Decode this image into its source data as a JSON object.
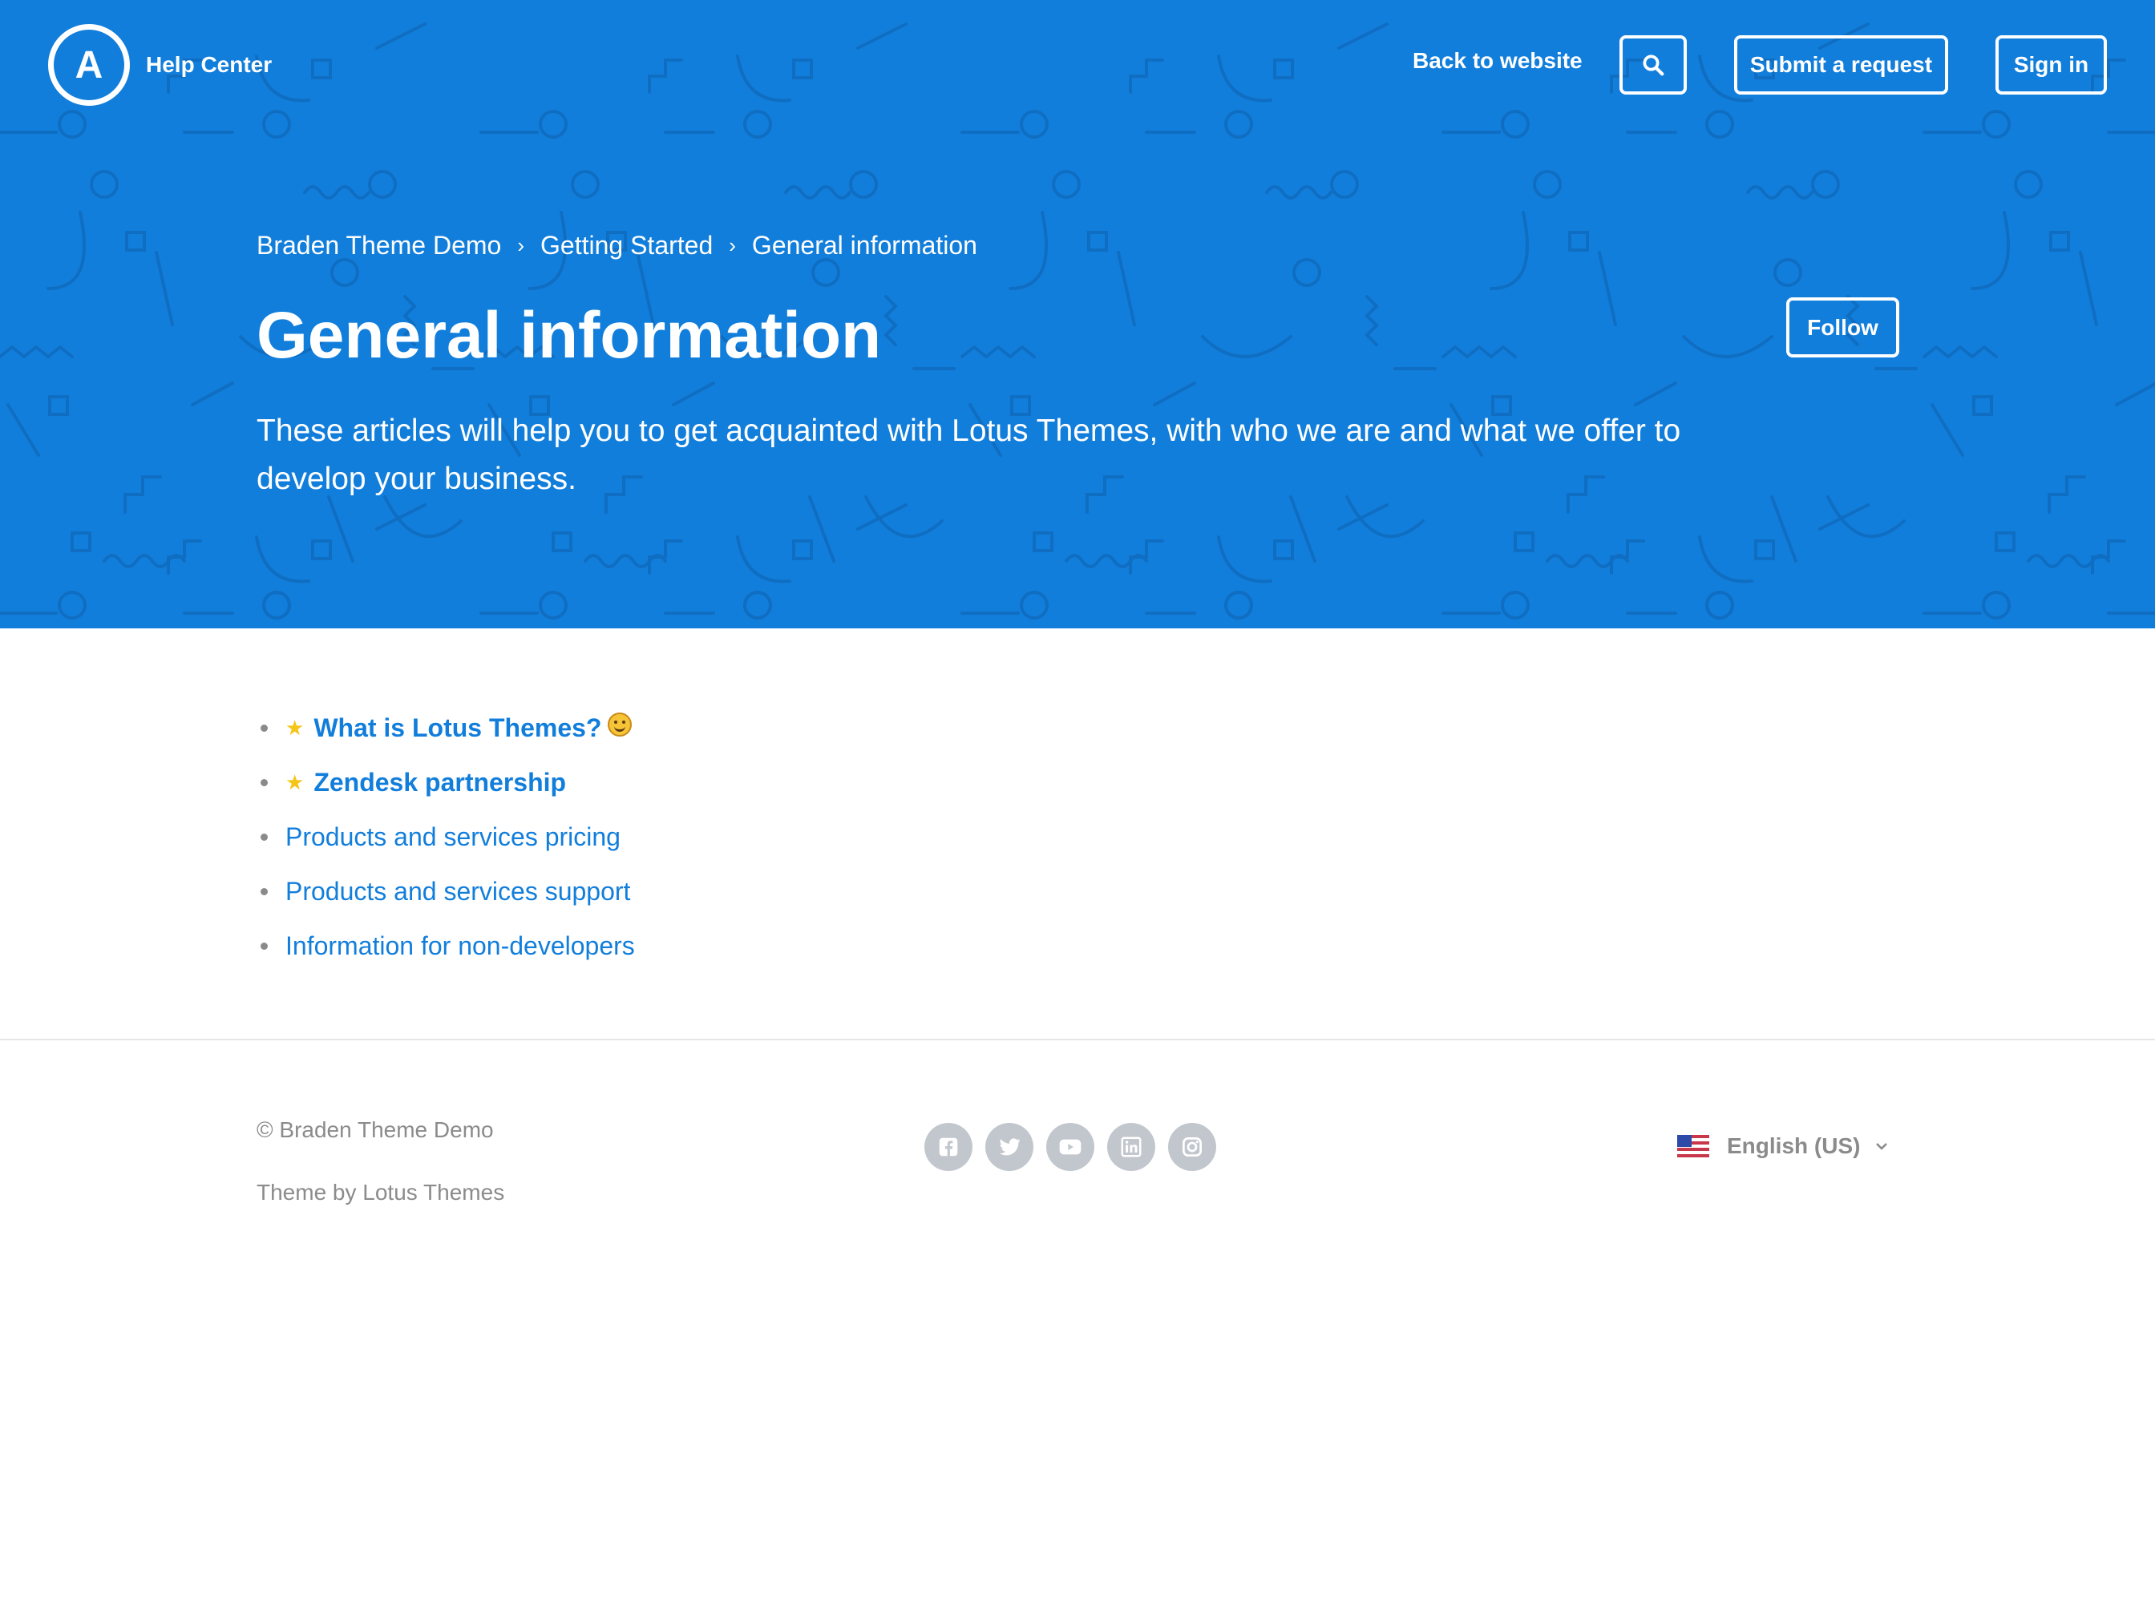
{
  "colors": {
    "brand_blue": "#127edb",
    "header_blue": "#127edb",
    "pattern_stroke": "#0f6ec2",
    "link_blue": "#127edb",
    "star_yellow": "#f5c518",
    "muted_gray": "#8b8b8b",
    "social_gray": "#c2c7ce"
  },
  "header": {
    "logo_letter": "A",
    "logo_text": "Help Center",
    "back_to_website": "Back to website",
    "search_icon": "search-icon",
    "submit_request": "Submit a request",
    "sign_in": "Sign in"
  },
  "breadcrumbs": [
    {
      "label": "Braden Theme Demo"
    },
    {
      "label": "Getting Started"
    },
    {
      "label": "General information"
    }
  ],
  "breadcrumb_separator": "›",
  "section": {
    "title": "General information",
    "description": "These articles will help you to get acquainted with Lotus Themes, with who we are and what we offer to develop your business.",
    "follow_label": "Follow"
  },
  "articles": [
    {
      "title": "What is Lotus Themes?",
      "promoted": true,
      "icon": "star-icon",
      "emoji": "smiling-face-emoji"
    },
    {
      "title": "Zendesk partnership",
      "promoted": true,
      "icon": "star-icon"
    },
    {
      "title": "Products and services pricing",
      "promoted": false
    },
    {
      "title": "Products and services support",
      "promoted": false
    },
    {
      "title": "Information for non-developers",
      "promoted": false
    }
  ],
  "footer": {
    "copyright": "© Braden Theme Demo",
    "theme_credit": "Theme by Lotus Themes",
    "social": [
      {
        "name": "facebook-icon"
      },
      {
        "name": "twitter-icon"
      },
      {
        "name": "youtube-icon"
      },
      {
        "name": "linkedin-icon"
      },
      {
        "name": "instagram-icon"
      }
    ],
    "language": "English (US)",
    "language_flag": "us-flag-icon",
    "language_chevron": "chevron-down-icon"
  }
}
